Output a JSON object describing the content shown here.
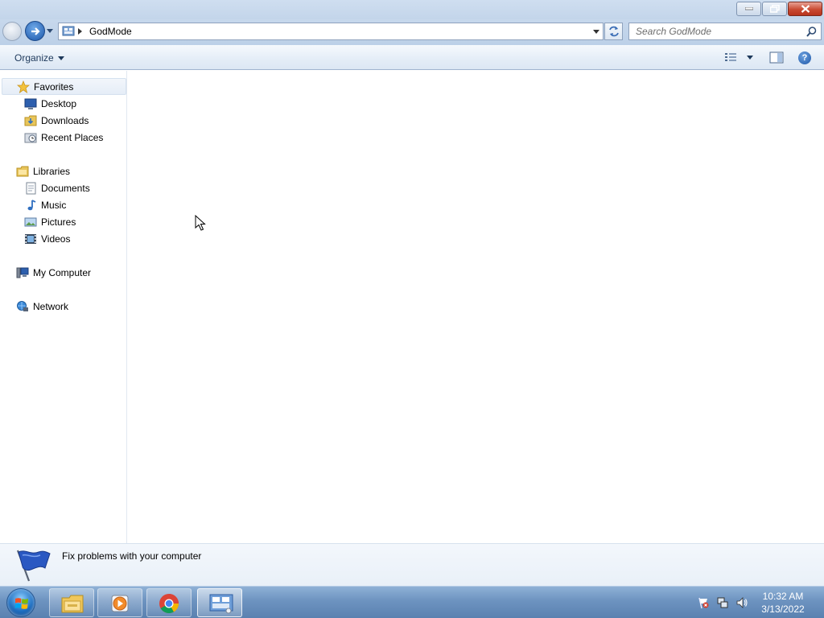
{
  "window": {
    "controls": [
      "minimize",
      "maximize",
      "close"
    ]
  },
  "address_bar": {
    "breadcrumb": "GodMode",
    "search_placeholder": "Search GodMode"
  },
  "command_bar": {
    "organize_label": "Organize"
  },
  "nav_pane": {
    "favorites": {
      "label": "Favorites",
      "icon": "star-icon"
    },
    "favorites_items": [
      {
        "label": "Desktop",
        "icon": "desktop-icon"
      },
      {
        "label": "Downloads",
        "icon": "downloads-folder-icon"
      },
      {
        "label": "Recent Places",
        "icon": "recent-places-icon"
      }
    ],
    "libraries": {
      "label": "Libraries",
      "icon": "libraries-icon"
    },
    "libraries_items": [
      {
        "label": "Documents",
        "icon": "documents-icon"
      },
      {
        "label": "Music",
        "icon": "music-icon"
      },
      {
        "label": "Pictures",
        "icon": "pictures-icon"
      },
      {
        "label": "Videos",
        "icon": "videos-icon"
      }
    ],
    "computer": {
      "label": "My Computer",
      "icon": "computer-icon"
    },
    "network": {
      "label": "Network",
      "icon": "network-icon"
    }
  },
  "details_pane": {
    "message": "Fix problems with your computer"
  },
  "taskbar": {
    "pinned": [
      "explorer-icon",
      "media-player-icon",
      "chrome-icon",
      "control-panel-icon"
    ],
    "clock_time": "10:32 AM",
    "clock_date": "3/13/2022"
  },
  "colors": {
    "accent": "#1e395b",
    "taskbar": "#6d93c0",
    "close_button": "#c94a32"
  }
}
